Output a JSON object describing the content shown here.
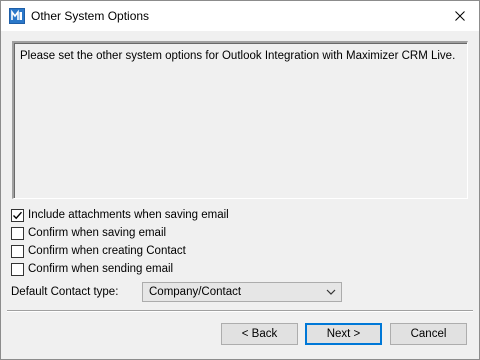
{
  "window": {
    "title": "Other System Options",
    "close_glyph": "✕"
  },
  "content": {
    "message": "Please set the other system options for Outlook Integration with Maximizer CRM Live."
  },
  "options": [
    {
      "label": "Include attachments when saving email",
      "checked": true
    },
    {
      "label": "Confirm when saving email",
      "checked": false
    },
    {
      "label": "Confirm when creating Contact",
      "checked": false
    },
    {
      "label": "Confirm when sending email",
      "checked": false
    }
  ],
  "default_contact_type": {
    "label": "Default Contact type:",
    "selected": "Company/Contact"
  },
  "buttons": {
    "back": "< Back",
    "next": "Next >",
    "cancel": "Cancel"
  },
  "icons": {
    "app": "maximizer-app-icon",
    "close": "close-icon",
    "checkmark": "checkmark-icon",
    "dropdown": "chevron-down-icon"
  },
  "colors": {
    "accent": "#0078d7",
    "window_bg": "#f0f0f0",
    "titlebar_bg": "#ffffff"
  }
}
